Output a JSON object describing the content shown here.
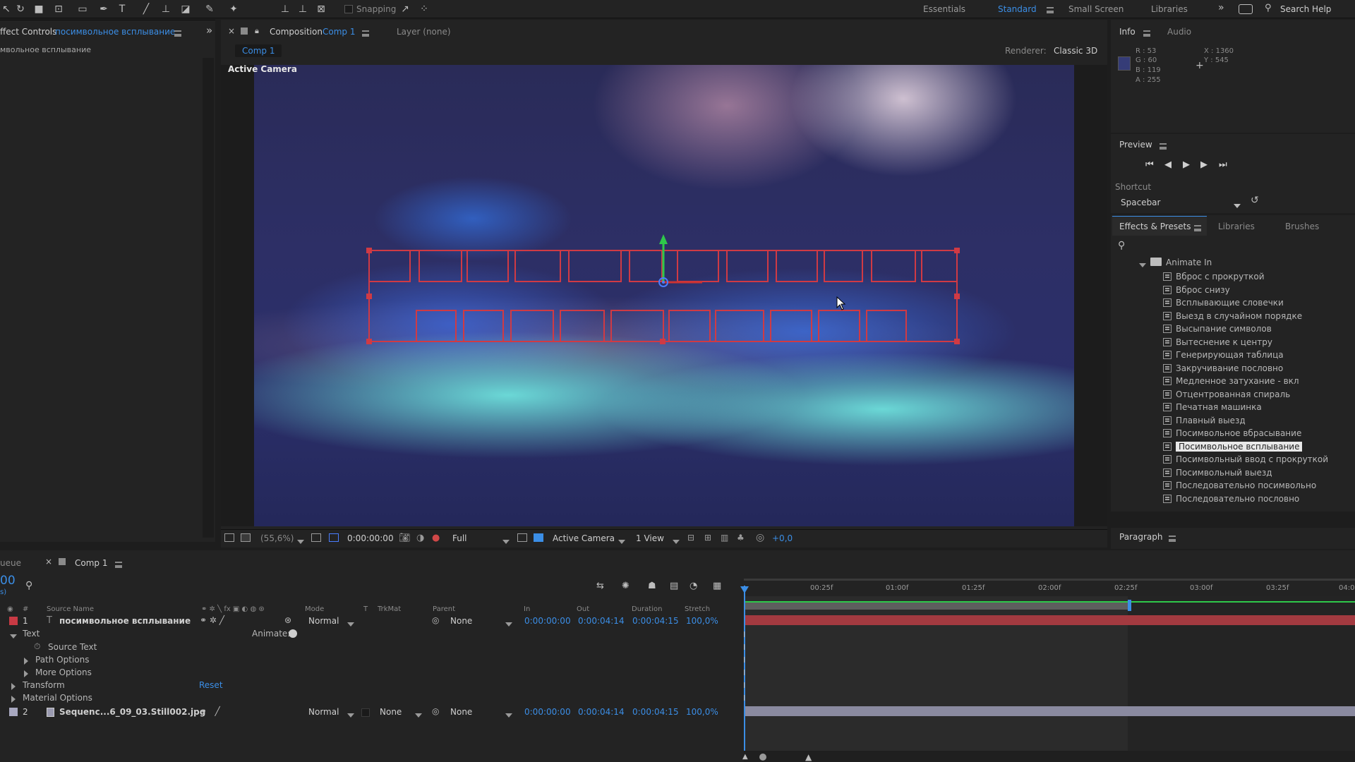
{
  "toolbar": {
    "snapping_label": "Snapping",
    "workspaces": [
      "Essentials",
      "Standard",
      "Small Screen",
      "Libraries"
    ],
    "active_workspace": "Standard",
    "search_help": "Search Help"
  },
  "effect_controls": {
    "tab_label": "ffect Controls",
    "layer_name": "посимвольное всплывание",
    "sub_label": "мвольное всплывание"
  },
  "composition": {
    "tab_prefix": "Composition",
    "comp_name": "Comp 1",
    "layer_tab": "Layer (none)",
    "comp_button": "Comp 1",
    "renderer_label": "Renderer:",
    "renderer_value": "Classic 3D",
    "active_camera_label": "Active Camera",
    "footer": {
      "zoom": "(55,6%)",
      "timecode": "0:00:00:00",
      "resolution": "Full",
      "camera": "Active Camera",
      "views": "1 View",
      "exposure": "+0,0"
    }
  },
  "info": {
    "tab": "Info",
    "audio_tab": "Audio",
    "r": "R : 53",
    "g": "G : 60",
    "b": "B : 119",
    "a": "A : 255",
    "x": "X : 1360",
    "y": "Y : 545",
    "swatch_color": "#353c77"
  },
  "preview": {
    "title": "Preview",
    "shortcut_label": "Shortcut",
    "shortcut_value": "Spacebar"
  },
  "effects_presets": {
    "tab": "Effects & Presets",
    "libraries_tab": "Libraries",
    "brushes_tab": "Brushes",
    "folder": "Animate In",
    "items": [
      "Вброс с прокруткой",
      "Вброс снизу",
      "Всплывающие словечки",
      "Выезд в случайном порядке",
      "Высыпание символов",
      "Вытеснение к центру",
      "Генерирующая таблица",
      "Закручивание пословно",
      "Медленное затухание - вкл",
      "Отцентрованная спираль",
      "Печатная машинка",
      "Плавный выезд",
      "Посимвольное вбрасывание",
      "Посимвольное всплывание",
      "Посимвольный ввод с прокруткой",
      "Посимвольный выезд",
      "Последовательно посимвольно",
      "Последовательно пословно"
    ],
    "selected_item": "Посимвольное всплывание"
  },
  "paragraph": {
    "title": "Paragraph"
  },
  "timeline": {
    "queue_tab": "ueue",
    "comp_tab": "Comp 1",
    "time_display": "00",
    "time_sub": "s)",
    "ruler": [
      "00:25f",
      "01:00f",
      "01:25f",
      "02:00f",
      "02:25f",
      "03:00f",
      "03:25f",
      "04:0"
    ],
    "columns": {
      "hash": "#",
      "source_name": "Source Name",
      "mode": "Mode",
      "t": "T",
      "trkmat": "TrkMat",
      "parent": "Parent",
      "in": "In",
      "out": "Out",
      "duration": "Duration",
      "stretch": "Stretch"
    },
    "layers": [
      {
        "num": "1",
        "name": "посимвольное всплывание",
        "mode": "Normal",
        "trkmat": "",
        "parent": "None",
        "in": "0:00:00:00",
        "out": "0:00:04:14",
        "duration": "0:00:04:15",
        "stretch": "100,0%"
      },
      {
        "num": "2",
        "name": "Sequenc...6_09_03.Still002.jpg",
        "mode": "Normal",
        "trkmat": "None",
        "parent": "None",
        "in": "0:00:00:00",
        "out": "0:00:04:14",
        "duration": "0:00:04:15",
        "stretch": "100,0%"
      }
    ],
    "props": {
      "text": "Text",
      "animate": "Animate:",
      "source_text": "Source Text",
      "path_options": "Path Options",
      "more_options": "More Options",
      "transform": "Transform",
      "reset": "Reset",
      "material_options": "Material Options"
    }
  }
}
